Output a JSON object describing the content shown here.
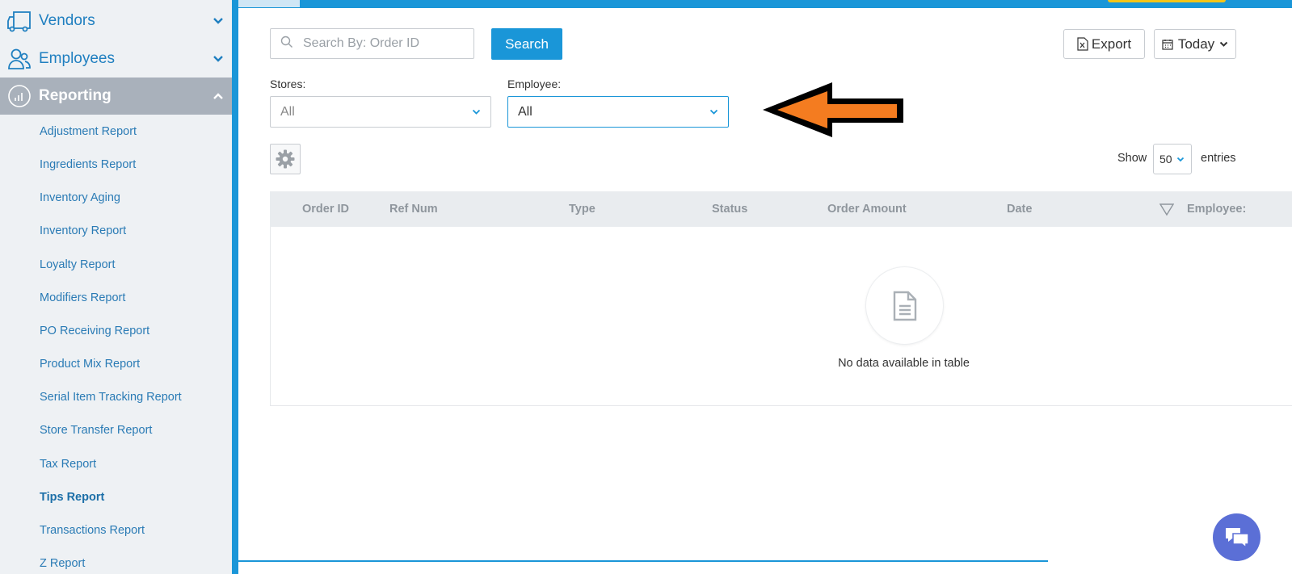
{
  "sidebar": {
    "vendors_label": "Vendors",
    "employees_label": "Employees",
    "reporting_label": "Reporting",
    "sub_items": [
      {
        "label": "Adjustment Report"
      },
      {
        "label": "Ingredients Report"
      },
      {
        "label": "Inventory Aging"
      },
      {
        "label": "Inventory Report"
      },
      {
        "label": "Loyalty Report"
      },
      {
        "label": "Modifiers Report"
      },
      {
        "label": "PO Receiving Report"
      },
      {
        "label": "Product Mix Report"
      },
      {
        "label": "Serial Item Tracking Report"
      },
      {
        "label": "Store Transfer Report"
      },
      {
        "label": "Tax Report"
      },
      {
        "label": "Tips Report"
      },
      {
        "label": "Transactions Report"
      },
      {
        "label": "Z Report"
      }
    ],
    "current_item": "Tips Report"
  },
  "search": {
    "placeholder": "Search By: Order ID",
    "value": "",
    "button_label": "Search"
  },
  "toolbar": {
    "export_label": "Export",
    "date_label": "Today"
  },
  "filters": {
    "stores_label": "Stores:",
    "stores_value": "All",
    "employee_label": "Employee:",
    "employee_value": "All"
  },
  "table_controls": {
    "show_label": "Show",
    "entries_value": "50",
    "entries_label": "entries"
  },
  "table": {
    "columns": [
      "Order ID",
      "Ref Num",
      "Type",
      "Status",
      "Order Amount",
      "Date",
      "Employee:"
    ],
    "empty_message": "No data available in table"
  },
  "colors": {
    "accent": "#1a96d8",
    "sidebar_bg": "#eef1f4",
    "active_nav_bg": "#a9b1bb",
    "arrow_fill": "#f47c20"
  }
}
